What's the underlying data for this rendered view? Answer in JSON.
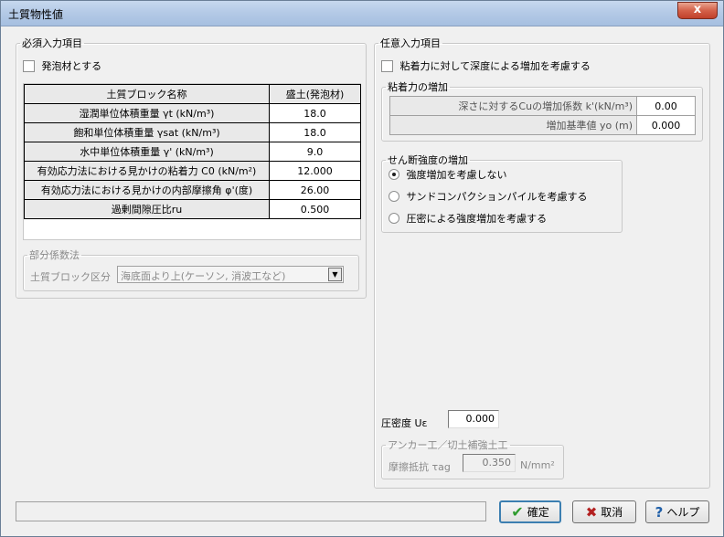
{
  "window": {
    "title": "土質物性値",
    "close": "x"
  },
  "required": {
    "legend": "必須入力項目",
    "foam_checkbox": "発泡材とする",
    "table": {
      "header_name": "土質ブロック名称",
      "header_value": "盛土(発泡材)",
      "rows": [
        {
          "label": "湿潤単位体積重量 γt  (kN/m³)",
          "value": "18.0"
        },
        {
          "label": "飽和単位体積重量 γsat (kN/m³)",
          "value": "18.0"
        },
        {
          "label": "水中単位体積重量 γ' (kN/m³)",
          "value": "9.0"
        },
        {
          "label": "有効応力法における見かけの粘着力 C0 (kN/m²)",
          "value": "12.000"
        },
        {
          "label": "有効応力法における見かけの内部摩擦角 φ'(度)",
          "value": "26.00"
        },
        {
          "label": "過剰間隙圧比ru",
          "value": "0.500"
        }
      ]
    },
    "partial": {
      "legend": "部分係数法",
      "block_label": "土質ブロック区分",
      "block_value": "海底面より上(ケーソン, 消波工など)"
    }
  },
  "optional": {
    "legend": "任意入力項目",
    "cohesion_checkbox": "粘着力に対して深度による増加を考慮する",
    "cohesion_group": {
      "legend": "粘着力の増加",
      "rows": [
        {
          "label": "深さに対するCuの増加係数 k'(kN/m³)",
          "value": "0.00"
        },
        {
          "label": "増加基準値 yo (m)",
          "value": "0.000"
        }
      ]
    },
    "shear_group": {
      "legend": "せん断強度の増加",
      "options": [
        {
          "label": "強度増加を考慮しない",
          "selected": true
        },
        {
          "label": "サンドコンパクションパイルを考慮する",
          "selected": false
        },
        {
          "label": "圧密による強度増加を考慮する",
          "selected": false
        }
      ]
    },
    "consolidation": {
      "label": "圧密度  Uε",
      "value": "0.000"
    },
    "anchor_group": {
      "legend": "アンカー工／切土補強土工",
      "friction_label": "摩擦抵抗 τag",
      "friction_value": "0.350",
      "unit": "N/mm²"
    }
  },
  "buttons": {
    "ok": "確定",
    "cancel": "取消",
    "help": "ヘルプ"
  }
}
